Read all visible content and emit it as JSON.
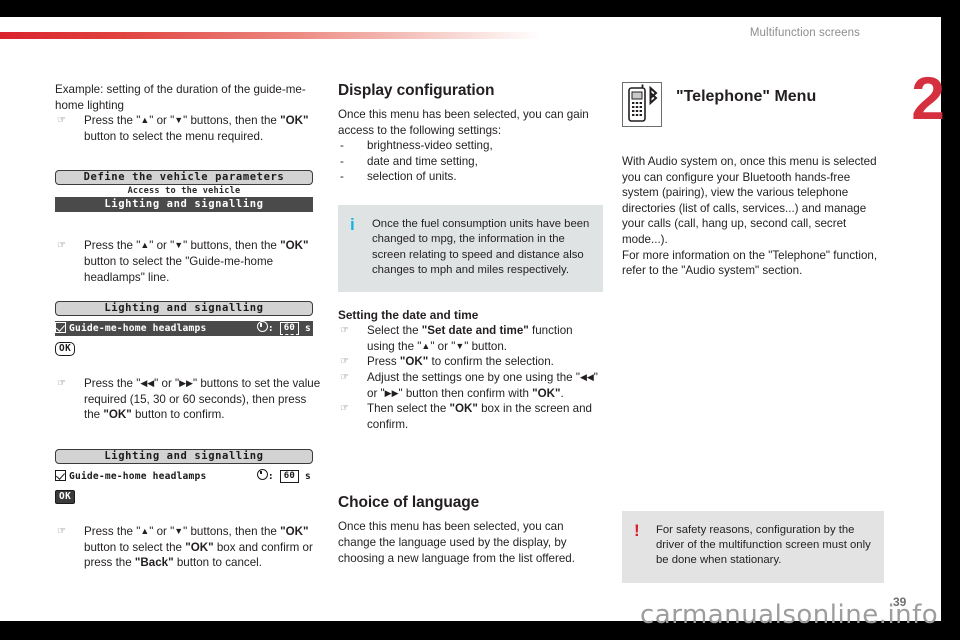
{
  "header": {
    "title": "Multifunction screens",
    "chapter_number": "2",
    "accent_color": "#d5303e"
  },
  "footer": {
    "watermark": "carmanualsonline.info",
    "page_number": "39"
  },
  "column_left": {
    "intro": "Example: setting of the duration of the guide-me-home lighting",
    "step1_a": "Press the \"",
    "step1_up": "▲",
    "step1_b": "\" or \"",
    "step1_down": "▼",
    "step1_c": "\" buttons, then the ",
    "step1_ok": "\"OK\"",
    "step1_d": " button to select the menu required.",
    "screen1": {
      "title": "Define the vehicle parameters",
      "subtitle": "Access to the vehicle",
      "selected_row": "Lighting and signalling"
    },
    "step2_a": "Press the \"",
    "step2_c": "\" buttons, then the ",
    "step2_ok": "\"OK\"",
    "step2_d": " button to select the \"Guide-me-home headlamps\" line.",
    "screen2": {
      "title": "Lighting and signalling",
      "item_label": "Guide-me-home headlamps",
      "item_checked": true,
      "clock_separator": ":",
      "value": "60",
      "unit": "s",
      "ok_label": "OK"
    },
    "step3_a": "Press the \"",
    "step3_rew": "◀◀",
    "step3_b": "\" or \"",
    "step3_fwd": "▶▶",
    "step3_c": "\" buttons to set the value required (15, 30 or 60 seconds), then press the ",
    "step3_ok": "\"OK\"",
    "step3_d": " button to confirm.",
    "screen3": {
      "title": "Lighting and signalling",
      "item_label": "Guide-me-home headlamps",
      "item_checked": true,
      "clock_separator": ":",
      "value": "60",
      "unit": "s",
      "ok_label": "OK"
    },
    "step4_a": "Press the \"",
    "step4_c": "\" buttons, then the ",
    "step4_ok1": "\"OK\"",
    "step4_d": " button to select the ",
    "step4_ok2": "\"OK\"",
    "step4_e": " box and confirm or press the ",
    "step4_back": "\"Back\"",
    "step4_f": " button to cancel."
  },
  "column_middle": {
    "display_config_title": "Display configuration",
    "display_config_intro": "Once this menu has been selected, you can gain access to the following settings:",
    "display_config_items": [
      "brightness-video setting,",
      "date and time setting,",
      "selection of units."
    ],
    "info_callout": {
      "icon": "info-icon",
      "icon_glyph": "i",
      "text": "Once the fuel consumption units have been changed to mpg, the information in the screen relating to speed and distance also changes to mph and miles respectively."
    },
    "datetime_title": "Setting the date and time",
    "dt_step1_a": "Select the ",
    "dt_step1_b": "\"Set date and time\"",
    "dt_step1_c": " function using the \"",
    "dt_step1_up": "▲",
    "dt_step1_d": "\" or \"",
    "dt_step1_down": "▼",
    "dt_step1_e": "\" button.",
    "dt_step2_a": "Press ",
    "dt_step2_ok": "\"OK\"",
    "dt_step2_b": " to confirm the selection.",
    "dt_step3_a": "Adjust the settings one by one using the \"",
    "dt_step3_rew": "◀◀",
    "dt_step3_b": "\" or \"",
    "dt_step3_fwd": "▶▶",
    "dt_step3_c": "\" button then confirm with ",
    "dt_step3_ok": "\"OK\"",
    "dt_step3_d": ".",
    "dt_step4_a": "Then select the ",
    "dt_step4_ok": "\"OK\"",
    "dt_step4_b": " box in the screen and confirm.",
    "language_title": "Choice of language",
    "language_text": "Once this menu has been selected, you can change the language used by the display, by choosing a new language from the list offered."
  },
  "column_right": {
    "telephone_icon": "mobile-phone-bluetooth-icon",
    "telephone_title": "\"Telephone\" Menu",
    "telephone_body_1": "With Audio system on, once this menu is selected you can configure your Bluetooth hands-free system (pairing), view the various telephone directories (list of calls, services...) and manage your calls (call, hang up, second call, secret mode...).",
    "telephone_body_2": "For more information on the \"Telephone\" function, refer to the \"Audio system\" section.",
    "warning_callout": {
      "icon": "warning-icon",
      "icon_glyph": "!",
      "text": "For safety reasons, configuration by the driver of the multifunction screen must only be done when stationary."
    }
  }
}
